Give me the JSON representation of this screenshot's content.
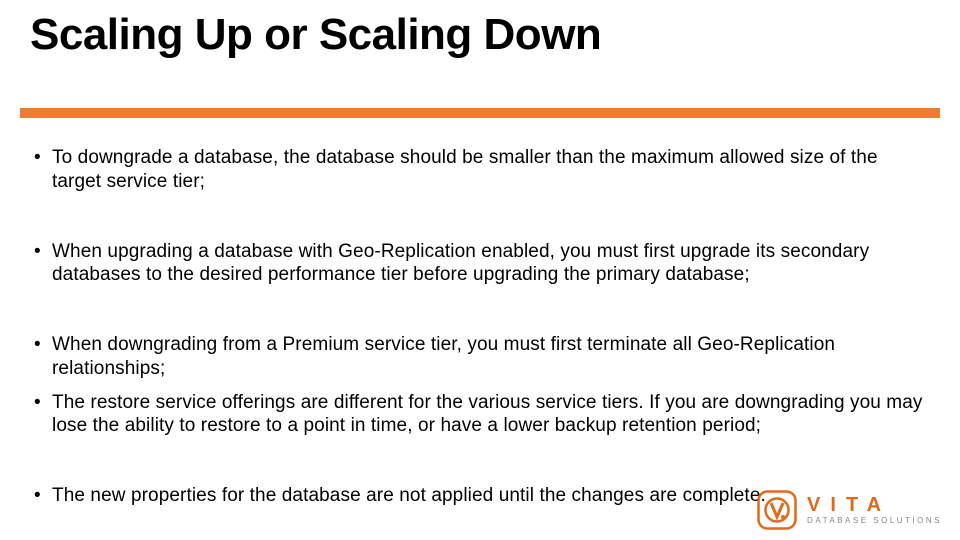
{
  "slide": {
    "title": "Scaling Up or Scaling Down",
    "bullets": [
      "To downgrade a database, the database should be smaller than the maximum allowed size of the target service tier;",
      "When upgrading a database with Geo-Replication enabled, you must first upgrade its secondary databases to the desired performance tier before upgrading the primary database;",
      "When downgrading from a Premium service tier, you must first terminate all Geo-Replication relationships;",
      "The restore service offerings are different for the various service tiers. If you are downgrading you may lose the ability to restore to a point in time, or have a lower backup retention period;",
      "The new properties for the database are not applied until the changes are complete."
    ]
  },
  "logo": {
    "brand": "VITA",
    "subtitle": "DATABASE SOLUTIONS"
  },
  "colors": {
    "accent": "#ED7D31"
  }
}
